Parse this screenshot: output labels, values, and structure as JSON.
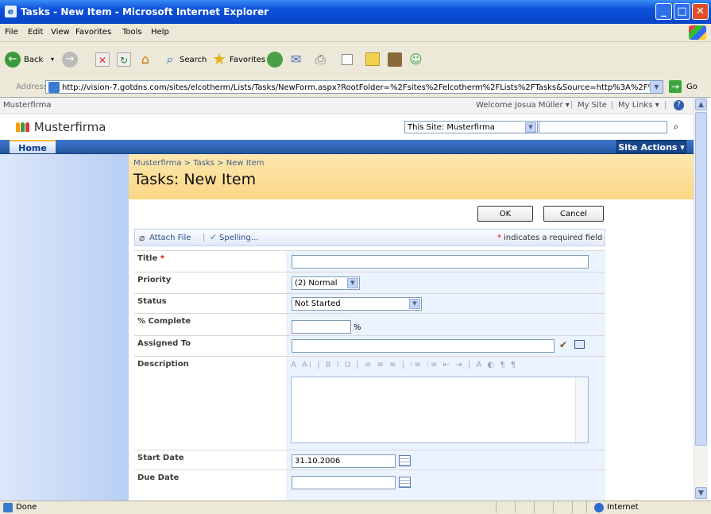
{
  "window": {
    "title": "Tasks - New Item - Microsoft Internet Explorer"
  },
  "menu": [
    "File",
    "Edit",
    "View",
    "Favorites",
    "Tools",
    "Help"
  ],
  "toolbar": {
    "back": "Back",
    "search": "Search",
    "favorites": "Favorites"
  },
  "address": {
    "label": "Address",
    "url": "http://vision-7.gotdns.com/sites/elcotherm/Lists/Tasks/NewForm.aspx?RootFolder=%2Fsites%2Felcotherm%2FLists%2FTasks&Source=http%3A%2F%2Fv",
    "go": "Go"
  },
  "sp": {
    "topsite": "Musterfirma",
    "welcome": "Welcome Josua Müller ▾",
    "mysite": "My Site",
    "mylinks": "My Links ▾",
    "logo": "Musterfirma",
    "scope": "This Site: Musterfirma",
    "home": "Home",
    "siteactions": "Site Actions ▾",
    "breadcrumb": "Musterfirma > Tasks > New Item",
    "title": "Tasks: New Item"
  },
  "form": {
    "ok": "OK",
    "cancel": "Cancel",
    "attach": "Attach File",
    "spelling": "Spelling...",
    "required_note": "indicates a required field",
    "fields": {
      "title": "Title",
      "priority": "Priority",
      "priority_value": "(2) Normal",
      "status": "Status",
      "status_value": "Not Started",
      "complete": "% Complete",
      "assigned": "Assigned To",
      "description": "Description",
      "start": "Start Date",
      "start_value": "31.10.2006",
      "due": "Due Date"
    },
    "percent": "%"
  },
  "status": {
    "done": "Done",
    "zone": "Internet"
  }
}
